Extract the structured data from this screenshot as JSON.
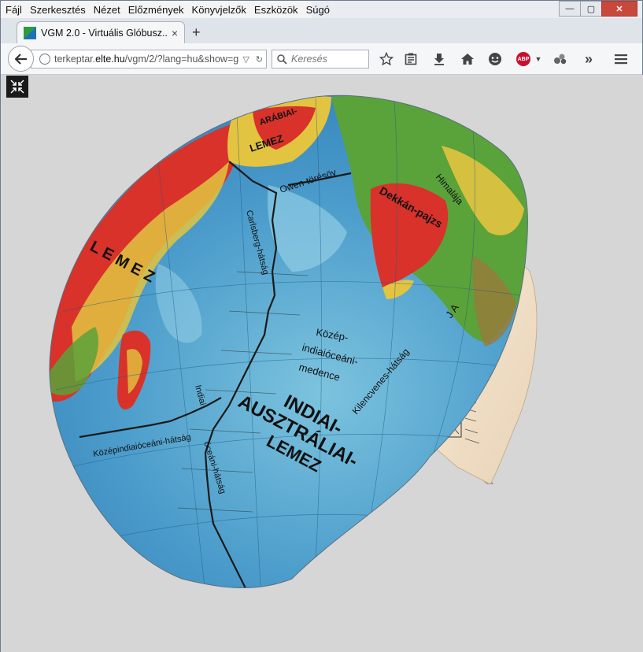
{
  "menu": {
    "items": [
      {
        "label": "Fájl"
      },
      {
        "label": "Szerkesztés"
      },
      {
        "label": "Nézet"
      },
      {
        "label": "Előzmények"
      },
      {
        "label": "Könyvjelzők"
      },
      {
        "label": "Eszközök"
      },
      {
        "label": "Súgó"
      }
    ]
  },
  "window_controls": {
    "minimize": "—",
    "maximize": "▢",
    "close": "✕"
  },
  "tab": {
    "title": "VGM 2.0 - Virtuális Glóbusz...",
    "close": "×"
  },
  "newtab": "+",
  "url": {
    "host_prefix": "terkeptar.",
    "host_bold": "elte.hu",
    "path": "/vgm/2/?lang=hu&show=g"
  },
  "search": {
    "placeholder": "Keresés"
  },
  "toolbar_icons": [
    "star-icon",
    "reading-list-icon",
    "download-icon",
    "home-icon",
    "chat-icon",
    "adblock-icon",
    "extension-icon",
    "overflow-icon",
    "menu-icon"
  ],
  "abp_label": "ABP",
  "map": {
    "labels": {
      "arabiai": "ARÁBIAI-",
      "lemez_top": "LEMEZ",
      "owen": "Owen-törésöv",
      "carlsberg": "Carlsberg-hátság",
      "dekkan": "Dekkán-pajzs",
      "himalaja": "Himalája",
      "lemez_left": "L E M E Z",
      "kozep": "Közép-",
      "indiaoceani": "indiaióceáni-",
      "medence": "medence",
      "kilencvenes": "Kilencvenes-hátság",
      "indiai": "INDIAI-",
      "ausztraliai": "AUSZTRÁLIAI-",
      "lemez_main": "LEMEZ",
      "keleti": "Középindiaióceáni-hátság",
      "oceani": "óceáni-hátság",
      "indiai_small": "Indiai",
      "ja": "J A"
    },
    "colors": {
      "ocean_deep": "#2f7fb8",
      "ocean_light": "#7cc3de",
      "land_green": "#5aa23a",
      "land_yellow": "#e2c440",
      "land_red": "#d8322a",
      "ridge": "#1a1a1a"
    }
  }
}
